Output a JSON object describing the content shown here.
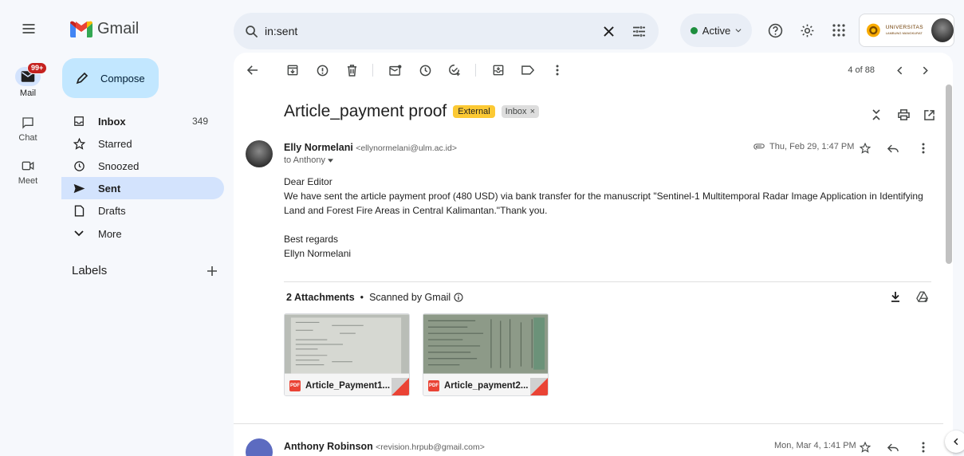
{
  "app": {
    "name": "Gmail"
  },
  "rail": {
    "badge": "99+",
    "items": [
      {
        "label": "Mail",
        "icon": "mail-icon"
      },
      {
        "label": "Chat",
        "icon": "chat-icon"
      },
      {
        "label": "Meet",
        "icon": "meet-icon"
      }
    ]
  },
  "nav": {
    "compose_label": "Compose",
    "items": [
      {
        "label": "Inbox",
        "count": "349",
        "icon": "inbox-icon"
      },
      {
        "label": "Starred",
        "count": "",
        "icon": "star-icon"
      },
      {
        "label": "Snoozed",
        "count": "",
        "icon": "clock-icon"
      },
      {
        "label": "Sent",
        "count": "",
        "icon": "send-icon"
      },
      {
        "label": "Drafts",
        "count": "",
        "icon": "draft-icon"
      },
      {
        "label": "More",
        "count": "",
        "icon": "chevron-down-icon"
      }
    ],
    "labels_heading": "Labels"
  },
  "search": {
    "value": "in:sent"
  },
  "status": {
    "label": "Active",
    "color": "#1e8e3e"
  },
  "org": {
    "name_line1": "UNIVERSITAS",
    "name_line2": "LAMBUNG MANGKURAT"
  },
  "toolbar": {
    "pager": "4 of 88"
  },
  "thread": {
    "subject": "Article_payment proof",
    "tag_external": "External",
    "tag_inbox": "Inbox",
    "tag_inbox_close": "×"
  },
  "message1": {
    "sender_name": "Elly Normelani",
    "sender_email": "<ellynormelani@ulm.ac.id>",
    "to": "to Anthony",
    "date": "Thu, Feb 29, 1:47 PM",
    "body": {
      "line1": "Dear Editor",
      "line2": "We have sent the article payment proof (480 USD) via bank transfer for the manuscript \"Sentinel-1 Multitemporal Radar Image Application in Identifying Land and Forest Fire Areas in Central Kalimantan.\"Thank you.",
      "line3": "Best regards",
      "line4": "Ellyn Normelani"
    },
    "attachments_title": "2 Attachments",
    "attachments_sep": "•",
    "scanned_label": "Scanned by Gmail",
    "attachments": [
      {
        "name": "Article_Payment1...",
        "type": "PDF"
      },
      {
        "name": "Article_payment2...",
        "type": "PDF"
      }
    ]
  },
  "message2": {
    "sender_name": "Anthony Robinson",
    "sender_email": "<revision.hrpub@gmail.com>",
    "date": "Mon, Mar 4, 1:41 PM",
    "avatar_color": "#5c6bc0"
  }
}
